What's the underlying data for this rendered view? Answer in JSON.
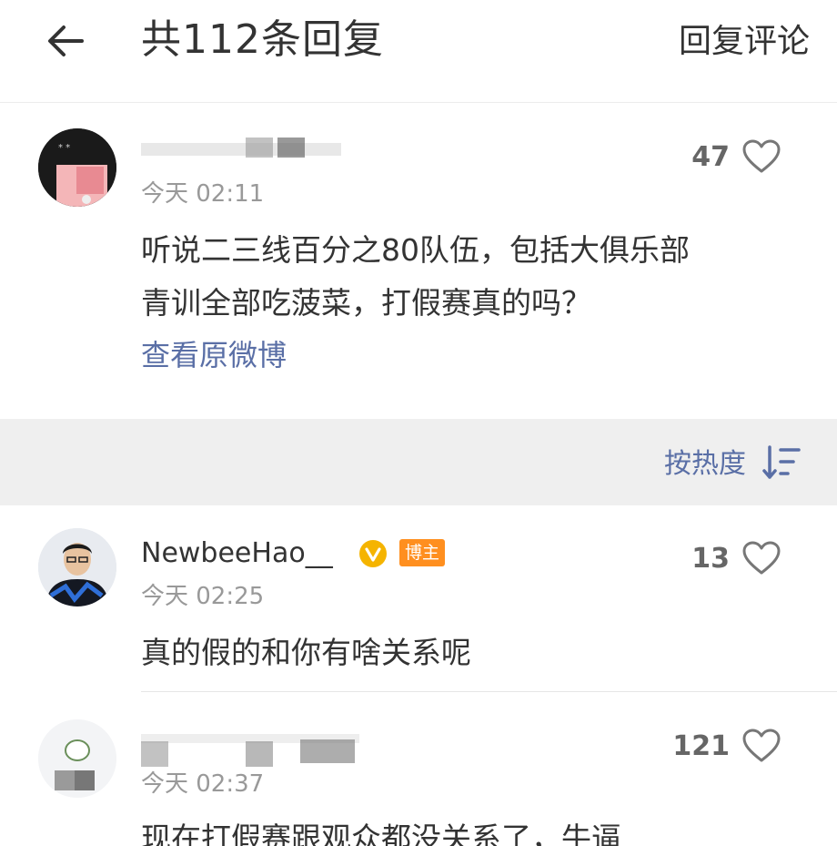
{
  "header": {
    "title": "共112条回复",
    "action": "回复评论"
  },
  "main_comment": {
    "username": "",
    "time": "今天 02:11",
    "likes": "47",
    "content_line1": "听说二三线百分之80队伍，包括大俱乐部",
    "content_line2": "青训全部吃菠菜，打假赛真的吗？",
    "view_original": "查看原微博"
  },
  "sort": {
    "label": "按热度"
  },
  "replies": [
    {
      "username": "NewbeeHao__",
      "badge": "博主",
      "time": "今天 02:25",
      "likes": "13",
      "content": "真的假的和你有啥关系呢"
    },
    {
      "username": "",
      "time": "今天 02:37",
      "likes": "121",
      "content": "现在打假赛跟观众都没关系了，牛逼"
    }
  ],
  "colors": {
    "link": "#5a6fa6",
    "badge": "#ff8f1f",
    "verified": "#f5b400",
    "sortbar_bg": "#efefef"
  },
  "icons": {
    "back": "arrow-left-icon",
    "like": "heart-outline-icon",
    "sort": "sort-descending-icon",
    "verified": "verified-v-icon"
  }
}
